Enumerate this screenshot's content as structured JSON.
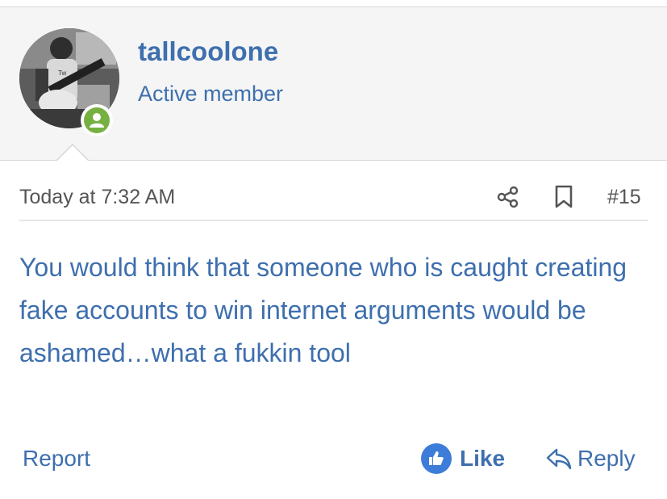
{
  "user": {
    "username": "tallcoolone",
    "title": "Active member",
    "avatar_icon": "user-avatar-photo",
    "status_icon": "online-status-icon",
    "status_color": "#76b041"
  },
  "post": {
    "timestamp": "Today at 7:32 AM",
    "number": "#15",
    "content": "You would think that someone who is caught creating fake accounts to win internet arguments would be ashamed…what a fukkin tool"
  },
  "actions": {
    "share_icon": "share-icon",
    "bookmark_icon": "bookmark-icon",
    "report_label": "Report",
    "like_label": "Like",
    "reply_label": "Reply"
  },
  "colors": {
    "link": "#3e6fae",
    "like_badge": "#3d7dd9",
    "header_bg": "#f5f5f5"
  }
}
